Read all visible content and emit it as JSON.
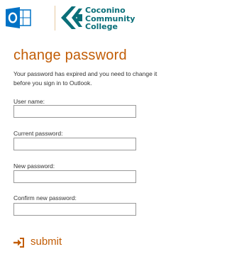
{
  "header": {
    "outlook_logo_icon": "outlook-icon",
    "college_icon": "ccc-logo-icon",
    "college_name": "Coconino\nCommunity\nCollege",
    "colors": {
      "outlook_blue": "#0072c6",
      "college_teal": "#0a6f79",
      "accent_orange": "#c25d06"
    }
  },
  "form": {
    "title": "change password",
    "description": "Your password has expired and you need to change it before you sign in to Outlook.",
    "fields": [
      {
        "label": "User name:",
        "value": ""
      },
      {
        "label": "Current password:",
        "value": ""
      },
      {
        "label": "New password:",
        "value": ""
      },
      {
        "label": "Confirm new password:",
        "value": ""
      }
    ],
    "submit_label": "submit",
    "submit_icon": "arrow-right-into-bracket-icon"
  }
}
